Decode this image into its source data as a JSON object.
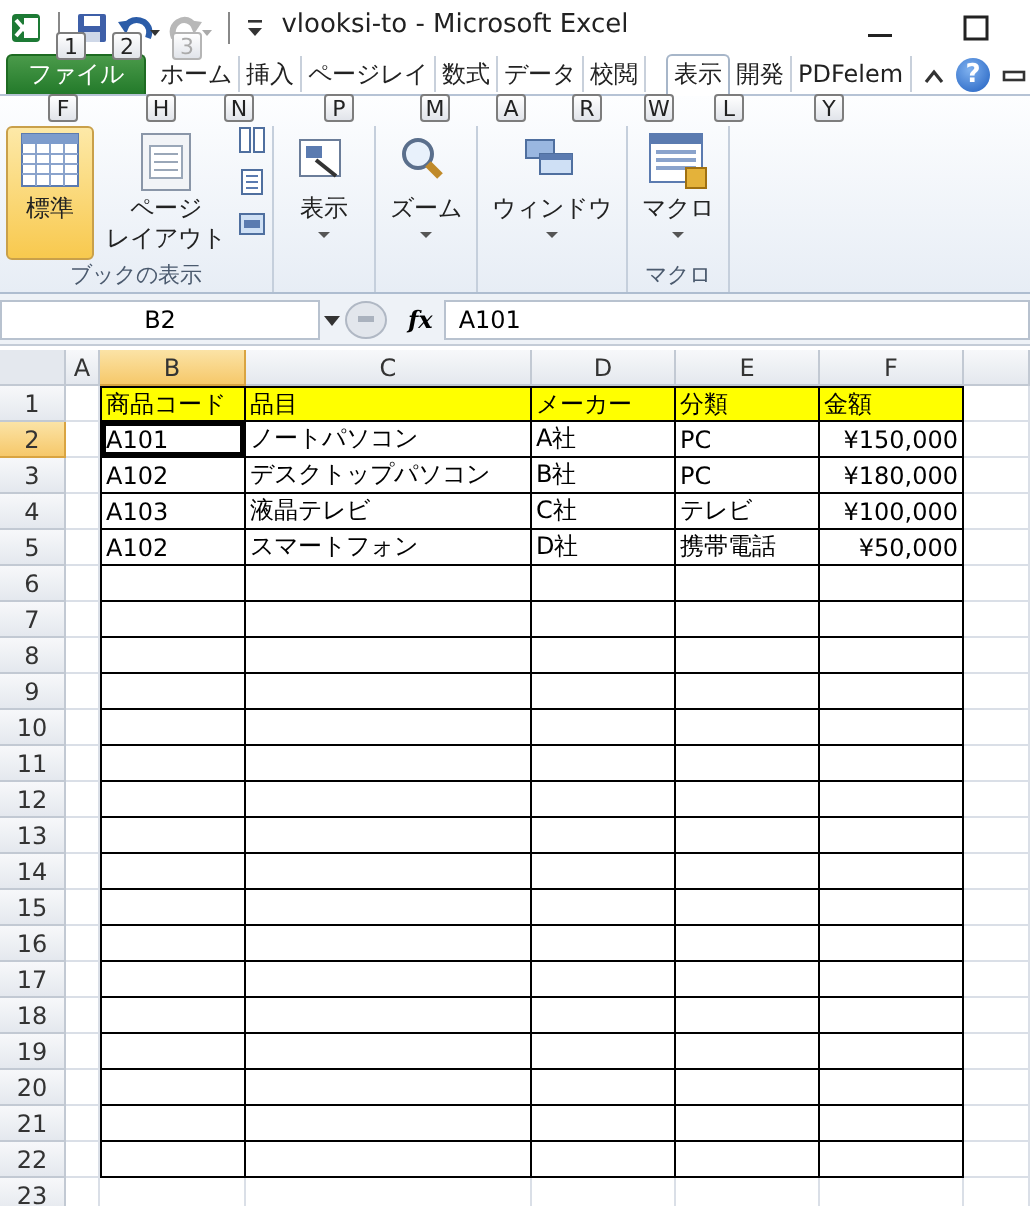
{
  "title_bar": {
    "title": "vlooksi-to - Microsoft Excel"
  },
  "key_tips": [
    {
      "label": "1",
      "disabled": false
    },
    {
      "label": "2",
      "disabled": false
    },
    {
      "label": "3",
      "disabled": true
    },
    {
      "label": "F",
      "disabled": false
    },
    {
      "label": "H",
      "disabled": false
    },
    {
      "label": "N",
      "disabled": false
    },
    {
      "label": "P",
      "disabled": false
    },
    {
      "label": "M",
      "disabled": false
    },
    {
      "label": "A",
      "disabled": false
    },
    {
      "label": "R",
      "disabled": false
    },
    {
      "label": "W",
      "disabled": false
    },
    {
      "label": "L",
      "disabled": false
    },
    {
      "label": "Y",
      "disabled": false
    }
  ],
  "ribbon_tabs": [
    {
      "label": "ファイル",
      "kind": "file",
      "selected": false
    },
    {
      "label": "ホーム",
      "kind": "tab",
      "selected": false
    },
    {
      "label": "挿入",
      "kind": "tab",
      "selected": false
    },
    {
      "label": "ページレイ",
      "kind": "tab",
      "selected": false
    },
    {
      "label": "数式",
      "kind": "tab",
      "selected": false
    },
    {
      "label": "データ",
      "kind": "tab",
      "selected": false
    },
    {
      "label": "校閲",
      "kind": "tab",
      "selected": false
    },
    {
      "label": "表示",
      "kind": "tab",
      "selected": true
    },
    {
      "label": "開発",
      "kind": "tab",
      "selected": false
    },
    {
      "label": "PDFelem",
      "kind": "tab",
      "selected": false
    }
  ],
  "help_button": {
    "label": "?"
  },
  "ribbon_groups": [
    {
      "label": "ブックの表示",
      "buttons": [
        {
          "label": "標準",
          "kind": "large",
          "selected": true
        },
        {
          "label_lines": [
            "ページ",
            "レイアウト"
          ],
          "kind": "large",
          "selected": false
        }
      ]
    },
    {
      "buttons": [
        {
          "label": "表示",
          "kind": "dropdown"
        }
      ]
    },
    {
      "buttons": [
        {
          "label": "ズーム",
          "kind": "dropdown"
        }
      ]
    },
    {
      "buttons": [
        {
          "label": "ウィンドウ",
          "kind": "dropdown"
        }
      ]
    },
    {
      "label": "マクロ",
      "buttons": [
        {
          "label": "マクロ",
          "kind": "dropdown"
        }
      ]
    }
  ],
  "formula_bar": {
    "name_box": "B2",
    "function_label": "fx",
    "formula": "A101"
  },
  "sheet": {
    "columns": [
      {
        "label": "A",
        "selected": false
      },
      {
        "label": "B",
        "selected": true
      },
      {
        "label": "C",
        "selected": false
      },
      {
        "label": "D",
        "selected": false
      },
      {
        "label": "E",
        "selected": false
      },
      {
        "label": "F",
        "selected": false
      }
    ],
    "rows": [
      {
        "number": "1",
        "selected": false,
        "kind": "header",
        "bordered": true,
        "cells": [
          "商品コード",
          "品目",
          "メーカー",
          "分類",
          "金額"
        ]
      },
      {
        "number": "2",
        "selected": true,
        "kind": "data",
        "bordered": true,
        "cells": [
          "A101",
          "ノートパソコン",
          "A社",
          "PC",
          "¥150,000"
        ]
      },
      {
        "number": "3",
        "selected": false,
        "kind": "data",
        "bordered": true,
        "cells": [
          "A102",
          "デスクトップパソコン",
          "B社",
          "PC",
          "¥180,000"
        ]
      },
      {
        "number": "4",
        "selected": false,
        "kind": "data",
        "bordered": true,
        "cells": [
          "A103",
          "液晶テレビ",
          "C社",
          "テレビ",
          "¥100,000"
        ]
      },
      {
        "number": "5",
        "selected": false,
        "kind": "data",
        "bordered": true,
        "cells": [
          "A102",
          "スマートフォン",
          "D社",
          "携帯電話",
          "¥50,000"
        ]
      },
      {
        "number": "6",
        "selected": false,
        "bordered": true
      },
      {
        "number": "7",
        "selected": false,
        "bordered": true
      },
      {
        "number": "8",
        "selected": false,
        "bordered": true
      },
      {
        "number": "9",
        "selected": false,
        "bordered": true
      },
      {
        "number": "10",
        "selected": false,
        "bordered": true
      },
      {
        "number": "11",
        "selected": false,
        "bordered": true
      },
      {
        "number": "12",
        "selected": false,
        "bordered": true
      },
      {
        "number": "13",
        "selected": false,
        "bordered": true
      },
      {
        "number": "14",
        "selected": false,
        "bordered": true
      },
      {
        "number": "15",
        "selected": false,
        "bordered": true
      },
      {
        "number": "16",
        "selected": false,
        "bordered": true
      },
      {
        "number": "17",
        "selected": false,
        "bordered": true
      },
      {
        "number": "18",
        "selected": false,
        "bordered": true
      },
      {
        "number": "19",
        "selected": false,
        "bordered": true
      },
      {
        "number": "20",
        "selected": false,
        "bordered": true
      },
      {
        "number": "21",
        "selected": false,
        "bordered": true
      },
      {
        "number": "22",
        "selected": false,
        "bordered": true
      },
      {
        "number": "23",
        "selected": false,
        "bordered": false
      }
    ]
  }
}
